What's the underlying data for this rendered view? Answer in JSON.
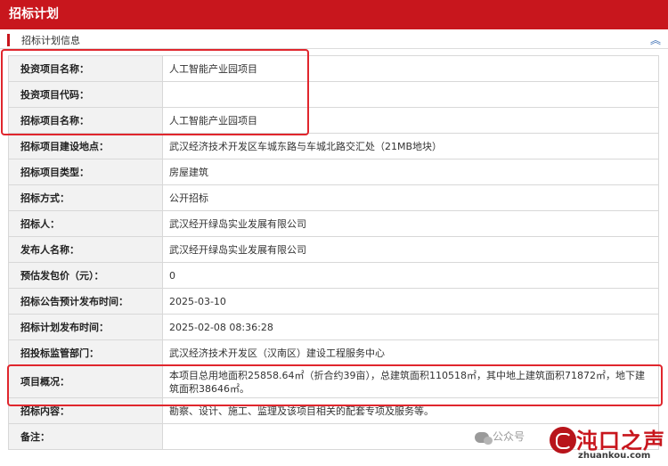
{
  "header": {
    "title": "招标计划"
  },
  "section": {
    "title": "招标计划信息",
    "collapse_icon": "chevrons-up-icon"
  },
  "rows": [
    {
      "label": "投资项目名称：",
      "value": "人工智能产业园项目"
    },
    {
      "label": "投资项目代码：",
      "value": ""
    },
    {
      "label": "招标项目名称：",
      "value": "人工智能产业园项目"
    },
    {
      "label": "招标项目建设地点：",
      "value": "武汉经济技术开发区车城东路与车城北路交汇处（21MB地块）"
    },
    {
      "label": "招标项目类型：",
      "value": "房屋建筑"
    },
    {
      "label": "招标方式：",
      "value": "公开招标"
    },
    {
      "label": "招标人：",
      "value": "武汉经开绿岛实业发展有限公司"
    },
    {
      "label": "发布人名称：",
      "value": "武汉经开绿岛实业发展有限公司"
    },
    {
      "label": "预估发包价（元）：",
      "value": "0"
    },
    {
      "label": "招标公告预计发布时间：",
      "value": "2025-03-10"
    },
    {
      "label": "招标计划发布时间：",
      "value": "2025-02-08 08:36:28"
    },
    {
      "label": "招投标监管部门：",
      "value": "武汉经济技术开发区（汉南区）建设工程服务中心"
    },
    {
      "label": "项目概况：",
      "value": "本项目总用地面积25858.64㎡（折合约39亩），总建筑面积110518㎡，其中地上建筑面积71872㎡，地下建筑面积38646㎡。"
    },
    {
      "label": "招标内容：",
      "value": "勘察、设计、施工、监理及该项目相关的配套专项及服务等。"
    },
    {
      "label": "备注：",
      "value": ""
    }
  ],
  "watermark": {
    "wechat_text": "公众号",
    "logo_text": "沌口之声",
    "url_text": "zhuankou.com"
  },
  "colors": {
    "brand_red": "#c8161d",
    "highlight_red": "#e0262d",
    "label_bg": "#f2f2f2",
    "link_blue": "#3a6db3"
  }
}
